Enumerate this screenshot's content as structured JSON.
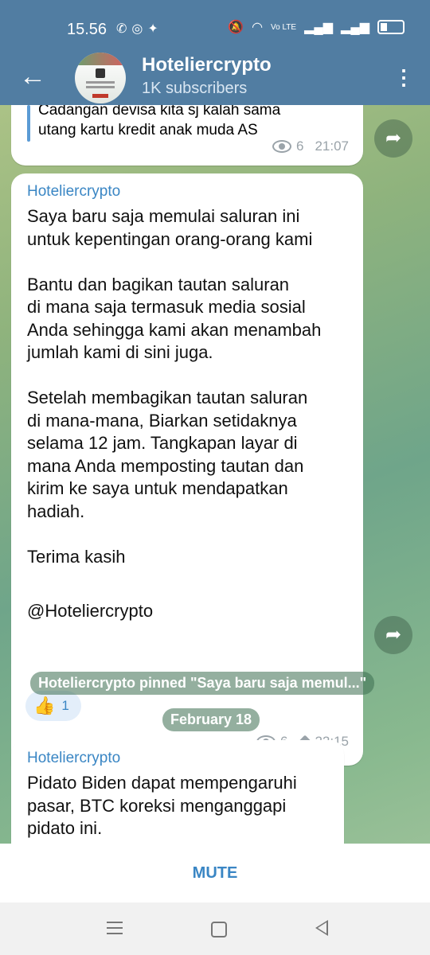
{
  "status_bar": {
    "time": "15.56",
    "app_icons": [
      "whatsapp-icon",
      "instagram-icon",
      "twitter-icon"
    ],
    "network_label": "Vo LTE",
    "colors": {
      "bar": "#517da2"
    }
  },
  "header": {
    "title": "Hoteliercrypto",
    "subtitle": "1K subscribers",
    "avatar_text": "hoteliercrypto"
  },
  "messages": [
    {
      "quote": "Cadangan devisa kita sj kalah sama\nutang kartu kredit anak muda AS",
      "views": "6",
      "time": "21:07"
    },
    {
      "sender": "Hoteliercrypto",
      "text": "Saya baru saja memulai saluran ini\nuntuk kepentingan orang-orang kami\n\nBantu dan bagikan tautan saluran\ndi mana saja termasuk media sosial\nAnda sehingga kami akan menambah\njumlah kami di sini juga.\n\nSetelah membagikan tautan saluran\ndi mana-mana, Biarkan setidaknya\nselama 12 jam. Tangkapan layar di\nmana Anda memposting tautan dan\nkirim ke saya untuk mendapatkan\nhadiah.\n\nTerima kasih",
      "mention": "@Hoteliercrypto",
      "reaction": {
        "emoji": "👍",
        "count": "1"
      },
      "views": "6",
      "time": "22:15"
    },
    {
      "sender": "Hoteliercrypto",
      "text": "Pidato Biden dapat mempengaruhi\npasar, BTC koreksi menganggapi\npidato ini."
    }
  ],
  "service": {
    "pinned": "Hoteliercrypto pinned \"Saya baru saja memul...\"",
    "date": "February 18"
  },
  "mute": {
    "label": "MUTE"
  }
}
